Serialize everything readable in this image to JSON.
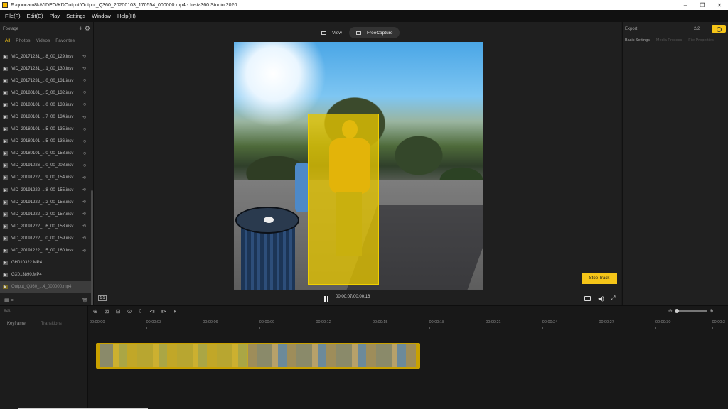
{
  "window": {
    "title": "F:/qoocam8k/VIDEO/KDOutput/Output_Q360_20200103_170554_000000.mp4 - Insta360 Studio 2020",
    "buttons": [
      "–",
      "❐",
      "✕"
    ]
  },
  "menu": [
    "File(F)",
    "Edit(E)",
    "Play",
    "Settings",
    "Window",
    "Help(H)"
  ],
  "sidebar": {
    "title": "Footage",
    "header_icons": "+ ⚙",
    "tabs": [
      "All",
      "Photos",
      "Videos",
      "Favorites"
    ],
    "active_tab": "All",
    "files": [
      "VID_20171231_...8_00_129.insv",
      "VID_20171231_...1_00_130.insv",
      "VID_20171231_...0_00_131.insv",
      "VID_20180101_...5_00_132.insv",
      "VID_20180101_...0_00_133.insv",
      "VID_20180101_...7_00_134.insv",
      "VID_20180101_...5_00_135.insv",
      "VID_20180101_...5_00_136.insv",
      "VID_20180101_...0_00_153.insv",
      "VID_20191026_...0_00_008.insv",
      "VID_20191222_...9_00_154.insv",
      "VID_20191222_...8_00_155.insv",
      "VID_20191222_...2_00_156.insv",
      "VID_20191222_...2_00_157.insv",
      "VID_20191222_...6_00_158.insv",
      "VID_20191222_...0_00_159.insv",
      "VID_20191222_...5_00_160.insv",
      "GH010322.MP4",
      "GX013890.MP4",
      "Output_Q360_...4_000000.mp4"
    ],
    "selected_index": 19,
    "footer_left": "▦ ≡",
    "footer_right": "🗑"
  },
  "preview": {
    "view_label": "View",
    "freecapture_label": "FreeCapture",
    "active_view": "FreeCapture",
    "stop_track_label": "Stop Track",
    "ratio_label": "1:1",
    "timecode": "00:00:07/00:00:16"
  },
  "right_panel": {
    "title": "Export",
    "count": "2/2",
    "tabs": [
      "Basic Settings",
      "Media Process",
      "File Properties"
    ],
    "active_tab": "Basic Settings"
  },
  "timeline": {
    "edit_label": "Edit",
    "tabs": [
      "Keyframe",
      "Transitions"
    ],
    "active_tab": "Keyframe",
    "tools": [
      "⊕",
      "⊠",
      "⊡",
      "⊙",
      "☾",
      "⧏",
      "⧐",
      "◗"
    ],
    "ruler": [
      "00:00:00",
      "00:00:03",
      "00:00:06",
      "00:00:09",
      "00:00:12",
      "00:00:15",
      "00:00:18",
      "00:00:21",
      "00:00:24",
      "00:00:27",
      "00:00:30",
      "00:00:3"
    ],
    "zoom_minus": "⊖",
    "zoom_plus": "⊕"
  }
}
